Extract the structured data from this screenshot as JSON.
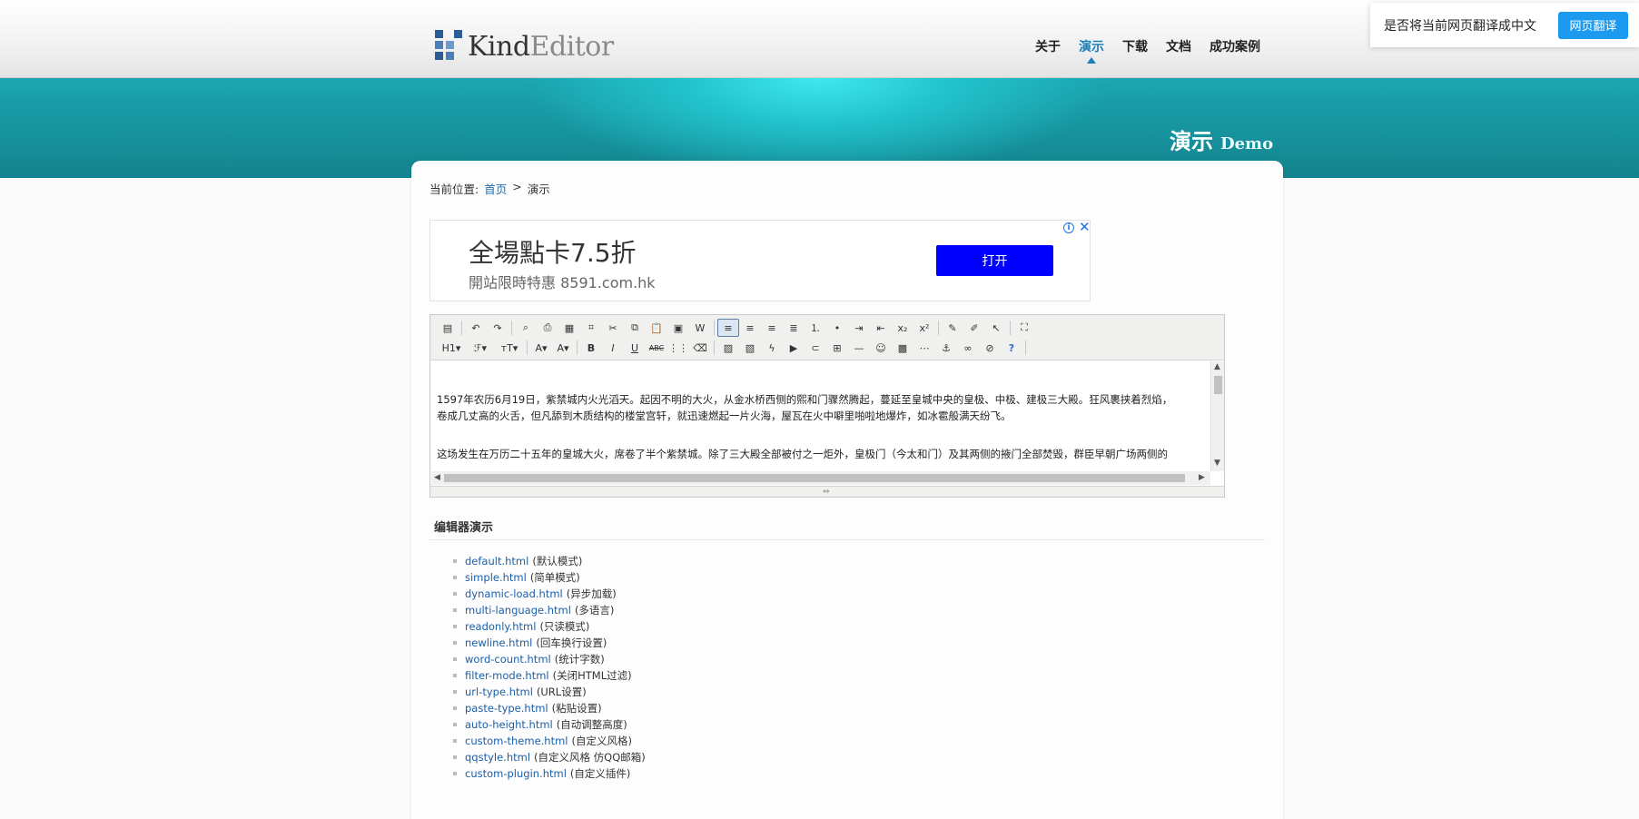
{
  "header": {
    "logo_kind": "Kind",
    "logo_editor": "Editor",
    "nav": [
      "关于",
      "演示",
      "下载",
      "文档",
      "成功案例"
    ],
    "active_nav": "演示"
  },
  "translate_bar": {
    "prompt": "是否将当前网页翻译成中文",
    "button": "网页翻译"
  },
  "banner": {
    "title_cn": "演示",
    "title_en": "Demo"
  },
  "breadcrumb": {
    "label": "当前位置:",
    "home": "首页",
    "separator": ">",
    "current": "演示"
  },
  "ad": {
    "headline": "全場點卡7.5折",
    "sub": "開站限時特惠 8591.com.hk",
    "button": "打开",
    "info": "i",
    "close": "✕"
  },
  "editor": {
    "toolbar_row1": [
      "source",
      "undo",
      "redo",
      "preview",
      "print",
      "template",
      "code",
      "cut",
      "copy",
      "paste",
      "plainpaste",
      "wordpaste",
      "align-left",
      "align-center",
      "align-right",
      "justify",
      "ordered-list",
      "unordered-list",
      "indent",
      "outdent",
      "subscript",
      "superscript",
      "clearhtml",
      "quickformat",
      "selectall",
      "fullscreen"
    ],
    "toolbar_row2": [
      "H1",
      "F",
      "TT",
      "A",
      "A",
      "B",
      "I",
      "U",
      "ABC",
      "lineheight",
      "removeformat",
      "image",
      "multiimage",
      "flash",
      "media",
      "insertfile",
      "table",
      "hr",
      "emoticons",
      "baidumap",
      "pagebreak",
      "anchor",
      "link",
      "unlink",
      "about"
    ],
    "paragraphs": [
      "1597年农历6月19日，紫禁城内火光滔天。起因不明的大火，从金水桥西侧的熙和门骤然腾起，蔓延至皇城中央的皇极、中极、建极三大殿。狂风裹挟着烈焰，",
      "卷成几丈高的火舌，但凡舔到木质结构的楼堂宫轩，就迅速燃起一片火海，屋瓦在火中噼里啪啦地爆炸，如冰雹般满天纷飞。",
      "这场发生在万历二十五年的皇城大火，席卷了半个紫禁城。除了三大殿全部被付之一炬外，皇极门（今太和门）及其两侧的掖门全部焚毁，群臣早朝广场两侧的"
    ]
  },
  "demo": {
    "title": "编辑器演示",
    "items": [
      {
        "file": "default.html",
        "desc": "(默认模式)"
      },
      {
        "file": "simple.html",
        "desc": "(简单模式)"
      },
      {
        "file": "dynamic-load.html",
        "desc": "(异步加载)"
      },
      {
        "file": "multi-language.html",
        "desc": "(多语言)"
      },
      {
        "file": "readonly.html",
        "desc": "(只读模式)"
      },
      {
        "file": "newline.html",
        "desc": "(回车换行设置)"
      },
      {
        "file": "word-count.html",
        "desc": "(统计字数)"
      },
      {
        "file": "filter-mode.html",
        "desc": "(关闭HTML过滤)"
      },
      {
        "file": "url-type.html",
        "desc": "(URL设置)"
      },
      {
        "file": "paste-type.html",
        "desc": "(粘贴设置)"
      },
      {
        "file": "auto-height.html",
        "desc": "(自动调整高度)"
      },
      {
        "file": "custom-theme.html",
        "desc": "(自定义风格)"
      },
      {
        "file": "qqstyle.html",
        "desc": "(自定义风格 仿QQ邮箱)"
      },
      {
        "file": "custom-plugin.html",
        "desc": "(自定义插件)"
      }
    ]
  },
  "colors": {
    "banner": "#1ba6b1",
    "link": "#1b5fa8",
    "ad_button": "#0000ff",
    "translate_button": "#1c9af0"
  }
}
